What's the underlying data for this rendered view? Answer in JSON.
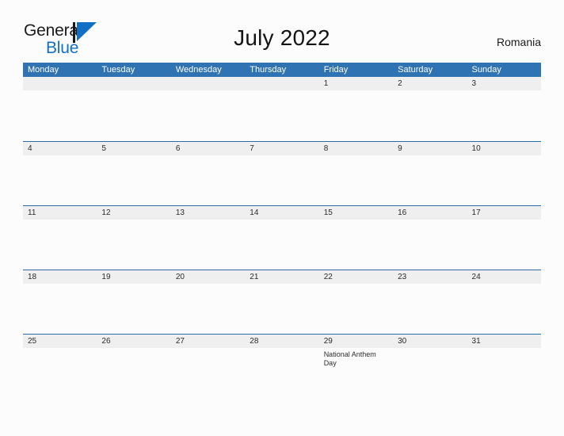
{
  "brand": {
    "name_line1": "General",
    "name_line2": "Blue",
    "flag_icon": "flag-triangle-icon",
    "accent_color": "#1170c4"
  },
  "header": {
    "title": "July 2022",
    "country": "Romania"
  },
  "theme": {
    "header_blue": "#3073b2",
    "band_gray": "#efefef",
    "band_rule": "#2a6ca8",
    "page_background": "#fcfcfc",
    "text_color": "#2b2b2b"
  },
  "calendar": {
    "month": "July",
    "year": "2022",
    "weekday_headers": [
      "Monday",
      "Tuesday",
      "Wednesday",
      "Thursday",
      "Friday",
      "Saturday",
      "Sunday"
    ],
    "weeks": [
      {
        "days": [
          {
            "number": "",
            "events": []
          },
          {
            "number": "",
            "events": []
          },
          {
            "number": "",
            "events": []
          },
          {
            "number": "",
            "events": []
          },
          {
            "number": "1",
            "events": []
          },
          {
            "number": "2",
            "events": []
          },
          {
            "number": "3",
            "events": []
          }
        ]
      },
      {
        "days": [
          {
            "number": "4",
            "events": []
          },
          {
            "number": "5",
            "events": []
          },
          {
            "number": "6",
            "events": []
          },
          {
            "number": "7",
            "events": []
          },
          {
            "number": "8",
            "events": []
          },
          {
            "number": "9",
            "events": []
          },
          {
            "number": "10",
            "events": []
          }
        ]
      },
      {
        "days": [
          {
            "number": "11",
            "events": []
          },
          {
            "number": "12",
            "events": []
          },
          {
            "number": "13",
            "events": []
          },
          {
            "number": "14",
            "events": []
          },
          {
            "number": "15",
            "events": []
          },
          {
            "number": "16",
            "events": []
          },
          {
            "number": "17",
            "events": []
          }
        ]
      },
      {
        "days": [
          {
            "number": "18",
            "events": []
          },
          {
            "number": "19",
            "events": []
          },
          {
            "number": "20",
            "events": []
          },
          {
            "number": "21",
            "events": []
          },
          {
            "number": "22",
            "events": []
          },
          {
            "number": "23",
            "events": []
          },
          {
            "number": "24",
            "events": []
          }
        ]
      },
      {
        "days": [
          {
            "number": "25",
            "events": []
          },
          {
            "number": "26",
            "events": []
          },
          {
            "number": "27",
            "events": []
          },
          {
            "number": "28",
            "events": []
          },
          {
            "number": "29",
            "events": [
              "National Anthem Day"
            ]
          },
          {
            "number": "30",
            "events": []
          },
          {
            "number": "31",
            "events": []
          }
        ]
      }
    ]
  }
}
